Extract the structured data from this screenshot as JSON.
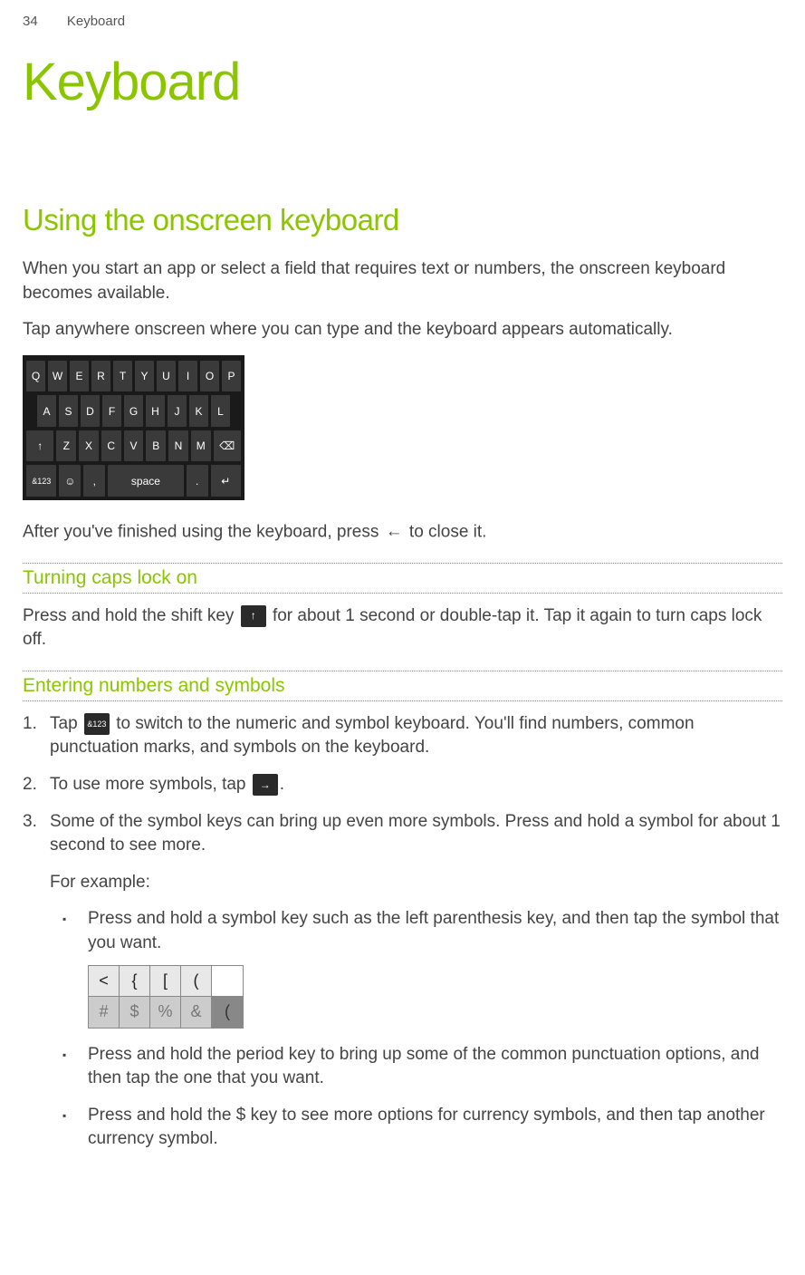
{
  "header": {
    "pageNumber": "34",
    "section": "Keyboard"
  },
  "title": "Keyboard",
  "sectionTitle": "Using the onscreen keyboard",
  "intro1": "When you start an app or select a field that requires text or numbers, the onscreen keyboard becomes available.",
  "intro2": "Tap anywhere onscreen where you can type and the keyboard appears automatically.",
  "kbRows": {
    "r1": [
      "Q",
      "W",
      "E",
      "R",
      "T",
      "Y",
      "U",
      "I",
      "O",
      "P"
    ],
    "r2": [
      "A",
      "S",
      "D",
      "F",
      "G",
      "H",
      "J",
      "K",
      "L"
    ],
    "r3": [
      "↑",
      "Z",
      "X",
      "C",
      "V",
      "B",
      "N",
      "M",
      "⌫"
    ],
    "r4": [
      "&123",
      "☺",
      ",",
      "space",
      ".",
      "↵"
    ]
  },
  "afterKb1": "After you've finished using the keyboard, press ",
  "afterKb2": " to close it.",
  "backIcon": "←",
  "subh1": "Turning caps lock on",
  "capsLock1": "Press and hold the shift key ",
  "capsLock2": " for about 1 second or double-tap it. Tap it again to turn caps lock off.",
  "shiftIcon": "↑",
  "subh2": "Entering numbers and symbols",
  "step1a": "Tap ",
  "step1b": " to switch to the numeric and symbol keyboard. You'll find numbers, common punctuation marks, and symbols on the keyboard.",
  "icon123": "&123",
  "step2a": "To use more symbols, tap ",
  "step2b": ".",
  "arrowIcon": "→",
  "step3": "Some of the symbol keys can bring up even more symbols. Press and hold a symbol for about 1 second to see more.",
  "forExample": "For example:",
  "bullet1": "Press and hold a symbol key such as the left parenthesis key, and then tap the symbol that you want.",
  "symbolsTop": [
    "<",
    "{",
    "[",
    "("
  ],
  "symbolsBot": [
    "#",
    "$",
    "%",
    "&",
    "("
  ],
  "bullet2": "Press and hold the period key to bring up some of the common punctuation options, and then tap the one that you want.",
  "bullet3": "Press and hold the $ key to see more options for currency symbols, and then tap another currency symbol."
}
